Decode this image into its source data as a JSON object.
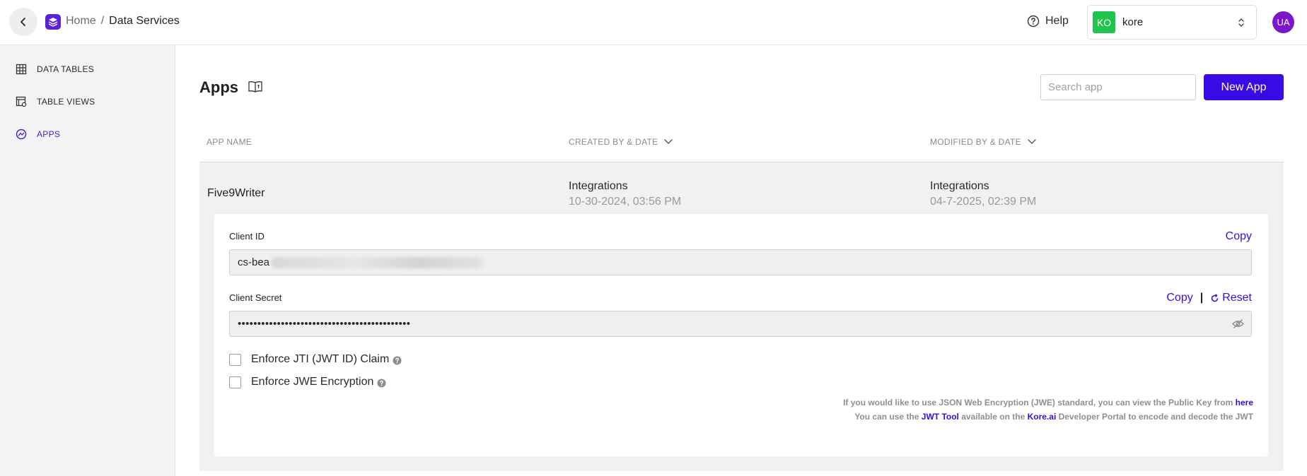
{
  "header": {
    "breadcrumb_home": "Home",
    "breadcrumb_sep": "/",
    "breadcrumb_current": "Data Services",
    "help_label": "Help",
    "account_badge": "KO",
    "account_name": "kore",
    "avatar_initials": "UA"
  },
  "sidebar": {
    "items": [
      {
        "label": "DATA TABLES",
        "icon": "table-grid-icon"
      },
      {
        "label": "TABLE VIEWS",
        "icon": "table-view-icon"
      },
      {
        "label": "APPS",
        "icon": "apps-icon",
        "active": true
      }
    ]
  },
  "main": {
    "title": "Apps",
    "search_placeholder": "Search app",
    "new_app_label": "New App",
    "columns": {
      "name": "APP NAME",
      "created": "CREATED BY & DATE",
      "modified": "MODIFIED BY & DATE"
    },
    "rows": [
      {
        "name": "Five9Writer",
        "created_by": "Integrations",
        "created_date": "10-30-2024, 03:56 PM",
        "modified_by": "Integrations",
        "modified_date": "04-7-2025, 02:39 PM"
      }
    ],
    "detail": {
      "client_id_label": "Client ID",
      "client_id_value": "cs-bea",
      "copy_label": "Copy",
      "client_secret_label": "Client Secret",
      "client_secret_value": "••••••••••••••••••••••••••••••••••••••••••••",
      "secret_copy_label": "Copy",
      "secret_divider": "|",
      "reset_label": "Reset",
      "jti_label": "Enforce JTI (JWT ID) Claim",
      "jwe_label": "Enforce JWE Encryption",
      "note_line1_prefix": "If you would like to use JSON Web Encryption (JWE) standard, you can view the Public Key from ",
      "note_line1_link": "here",
      "note_line2_a": "You can use the ",
      "note_line2_link1": "JWT Tool",
      "note_line2_b": " available on the ",
      "note_line2_link2": "Kore.ai",
      "note_line2_c": " Developer Portal to encode and decode the JWT"
    }
  },
  "colors": {
    "accent": "#3a0ae6",
    "sidebar_active": "#4c1cc4",
    "account_badge": "#1ec44d",
    "avatar": "#7a17c9"
  }
}
